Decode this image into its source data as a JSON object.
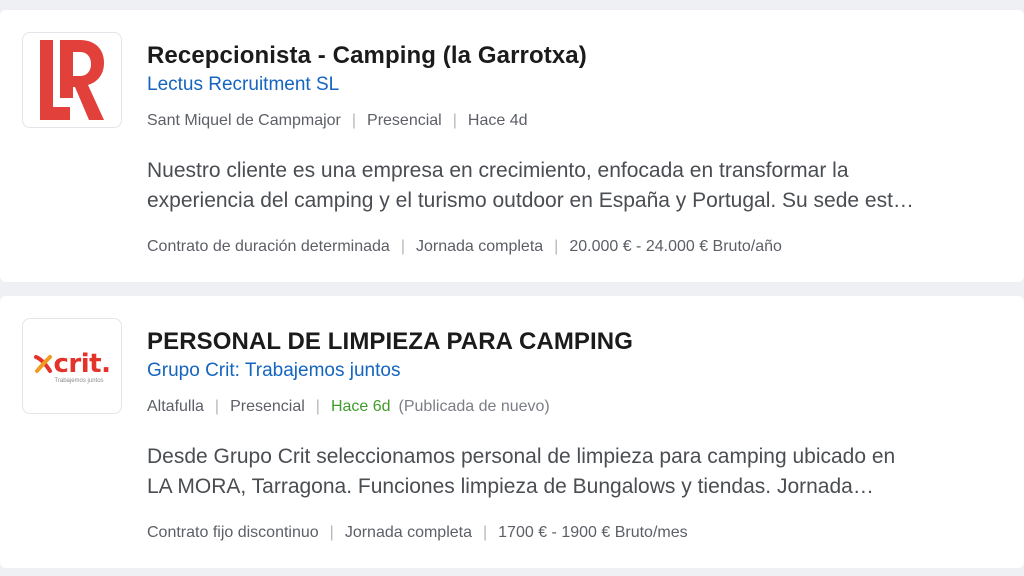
{
  "jobs": [
    {
      "logo": {
        "text": "LR",
        "icon": "lectus-logo-icon",
        "color": "#e2413b"
      },
      "title": "Recepcionista - Camping (la Garrotxa)",
      "company": "Lectus Recruitment SL",
      "location": "Sant Miquel de Campmajor",
      "modality": "Presencial",
      "posted": "Hace 4d",
      "description_line1": "Nuestro cliente es una empresa en crecimiento, enfocada en transformar la",
      "description_line2": "experiencia del camping y el turismo outdoor en España y Portugal. Su sede est…",
      "contract": "Contrato de duración determinada",
      "schedule": "Jornada completa",
      "salary": "20.000 € - 24.000 € Bruto/año"
    },
    {
      "logo": {
        "text": "crit.",
        "tagline": "Trabajemos juntos",
        "icon": "crit-logo-icon",
        "color": "#e4332b"
      },
      "title": "PERSONAL DE LIMPIEZA PARA CAMPING",
      "company": "Grupo Crit: Trabajemos juntos",
      "location": "Altafulla",
      "modality": "Presencial",
      "posted": "Hace 6d",
      "posted_note": "(Publicada de nuevo)",
      "description_line1": "Desde Grupo Crit seleccionamos personal de limpieza para camping ubicado en",
      "description_line2": "LA MORA, Tarragona. Funciones limpieza de Bungalows y tiendas. Jornada…",
      "contract": "Contrato fijo discontinuo",
      "schedule": "Jornada completa",
      "salary": "1700 € - 1900 € Bruto/mes"
    }
  ],
  "colors": {
    "link": "#1565c0",
    "recent": "#3f9b2b",
    "separator": "#b3b6bc"
  },
  "separator": "|"
}
